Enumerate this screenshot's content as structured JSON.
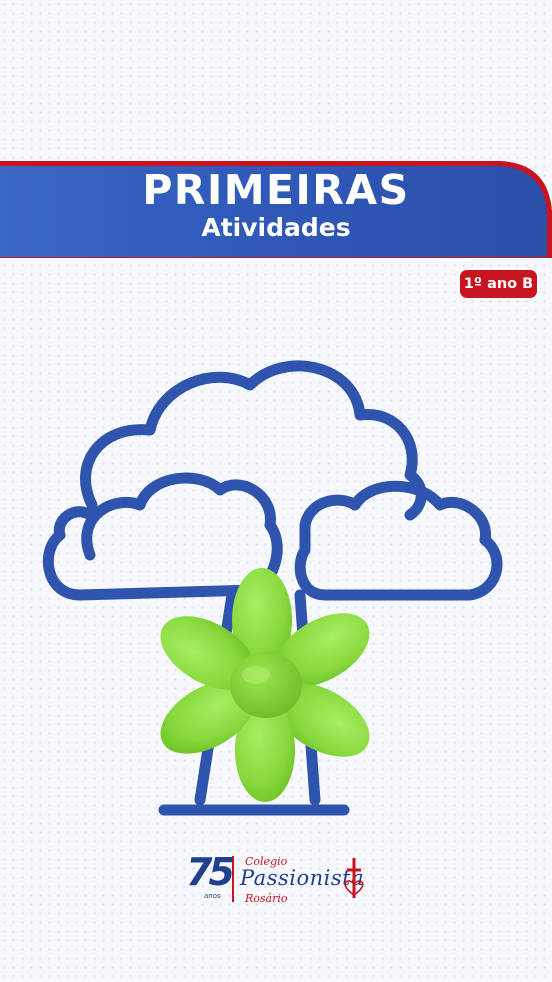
{
  "banner": {
    "title": "PRIMEIRAS",
    "subtitle": "Atividades"
  },
  "badge": {
    "label": "1º ano B"
  },
  "illustration": {
    "icons": [
      "tree-outline-icon",
      "clay-flower-icon"
    ]
  },
  "logo": {
    "number": "75",
    "anos": "anos",
    "top_text": "Colegio",
    "name": "Passionista",
    "bottom_text": "Rosário",
    "icon": "cross-heart-icon"
  },
  "colors": {
    "banner_blue": "#2c55b4",
    "banner_red": "#c8141e",
    "tree_blue": "#2f54ad",
    "flower_green": "#8fde46",
    "logo_blue": "#1f3f8f"
  }
}
